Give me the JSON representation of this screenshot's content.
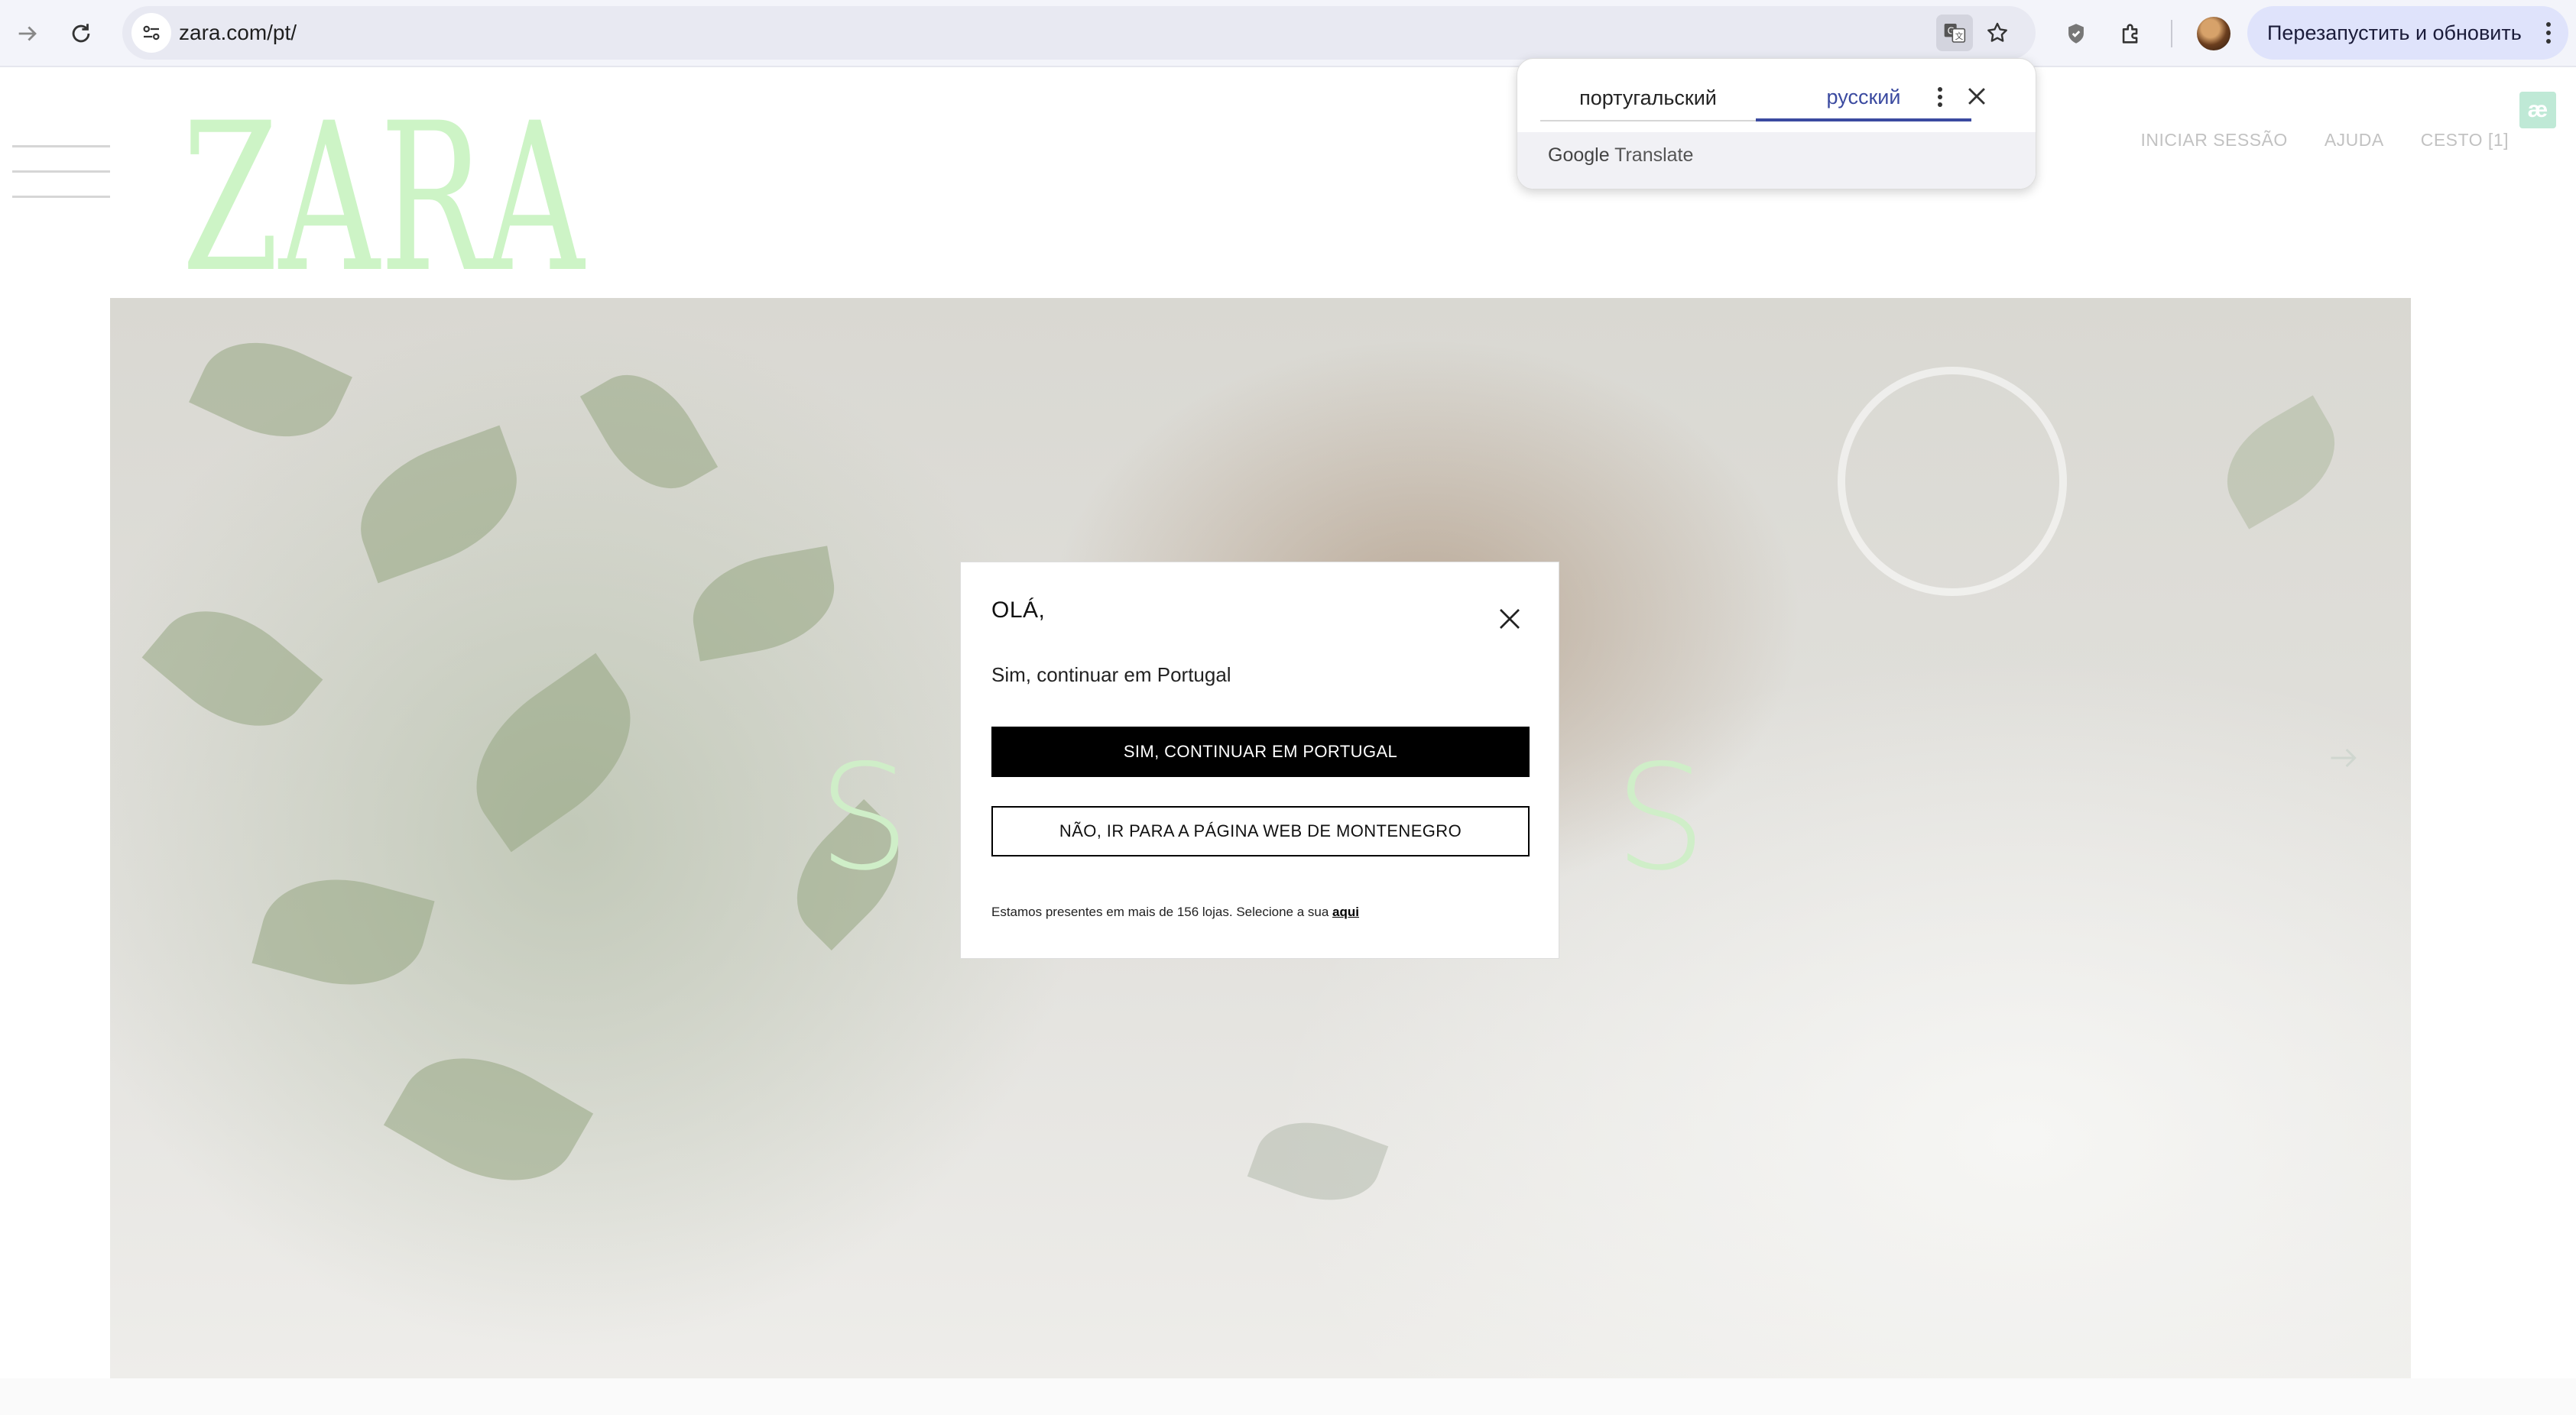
{
  "browser": {
    "url": "zara.com/pt/",
    "relaunch_label": "Перезапустить и обновить"
  },
  "translate_popup": {
    "source_language": "португальский",
    "target_language": "русский",
    "brand": "Google",
    "brand_suffix": "Translate"
  },
  "site": {
    "logo_text": "ZARA",
    "nav": {
      "login": "INICIAR SESSÃO",
      "help": "AJUDA",
      "basket": "CESTO [1]"
    },
    "badge": "æ",
    "hero_letters": [
      "S",
      "S"
    ]
  },
  "modal": {
    "title": "OLÁ,",
    "subtitle": "Sim, continuar em Portugal",
    "primary_button": "SIM, CONTINUAR EM PORTUGAL",
    "secondary_button": "NÃO, IR PARA A PÁGINA WEB DE MONTENEGRO",
    "footnote": "Estamos presentes em mais de 156 lojas. Selecione a sua ",
    "footnote_link": "aqui"
  },
  "colors": {
    "logo": "#cdf4c6",
    "accent_translate": "#3b4aa0",
    "relaunch_bg": "#dfe3fb"
  }
}
